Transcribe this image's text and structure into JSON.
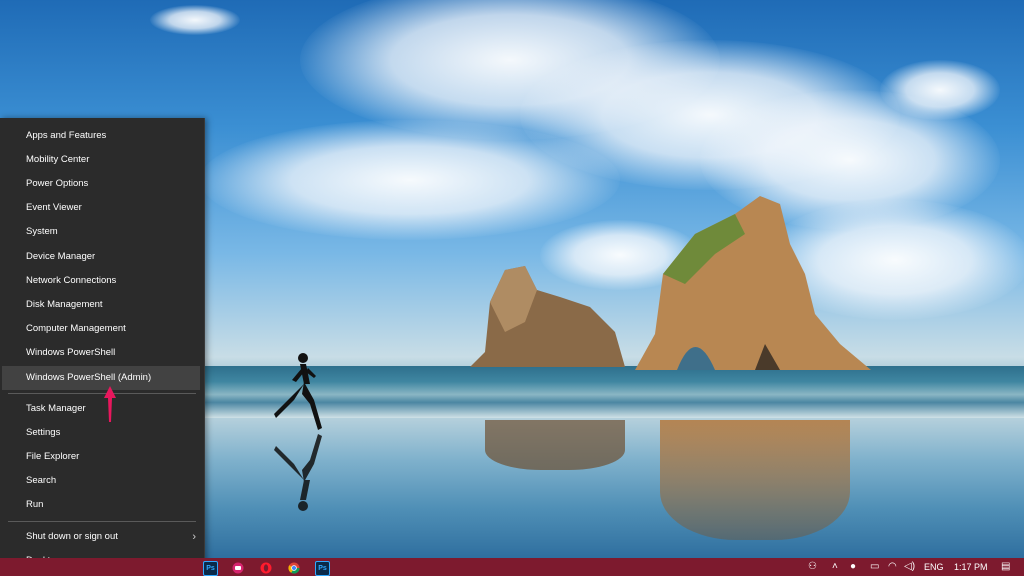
{
  "colors": {
    "menu_bg": "#2b2b2b",
    "menu_highlight": "#424242",
    "taskbar_bg": "#7d1a2e",
    "arrow": "#e8175d"
  },
  "menu": {
    "items": [
      {
        "label": "Apps and Features"
      },
      {
        "label": "Mobility Center"
      },
      {
        "label": "Power Options"
      },
      {
        "label": "Event Viewer"
      },
      {
        "label": "System"
      },
      {
        "label": "Device Manager"
      },
      {
        "label": "Network Connections"
      },
      {
        "label": "Disk Management"
      },
      {
        "label": "Computer Management"
      },
      {
        "label": "Windows PowerShell"
      },
      {
        "label": "Windows PowerShell (Admin)"
      },
      {
        "label": "Task Manager"
      },
      {
        "label": "Settings"
      },
      {
        "label": "File Explorer"
      },
      {
        "label": "Search"
      },
      {
        "label": "Run"
      },
      {
        "label": "Shut down or sign out"
      },
      {
        "label": "Desktop"
      }
    ],
    "highlighted": "Windows PowerShell (Admin)"
  },
  "taskbar": {
    "apps": [
      {
        "icon": "photoshop-icon",
        "label": "Ps"
      },
      {
        "icon": "app-icon-pink",
        "label": ""
      },
      {
        "icon": "opera-icon",
        "label": ""
      },
      {
        "icon": "chrome-icon",
        "label": ""
      },
      {
        "icon": "photoshop-icon",
        "label": "Ps"
      }
    ],
    "tray": {
      "language": "ENG",
      "time": "1:17 PM"
    }
  }
}
